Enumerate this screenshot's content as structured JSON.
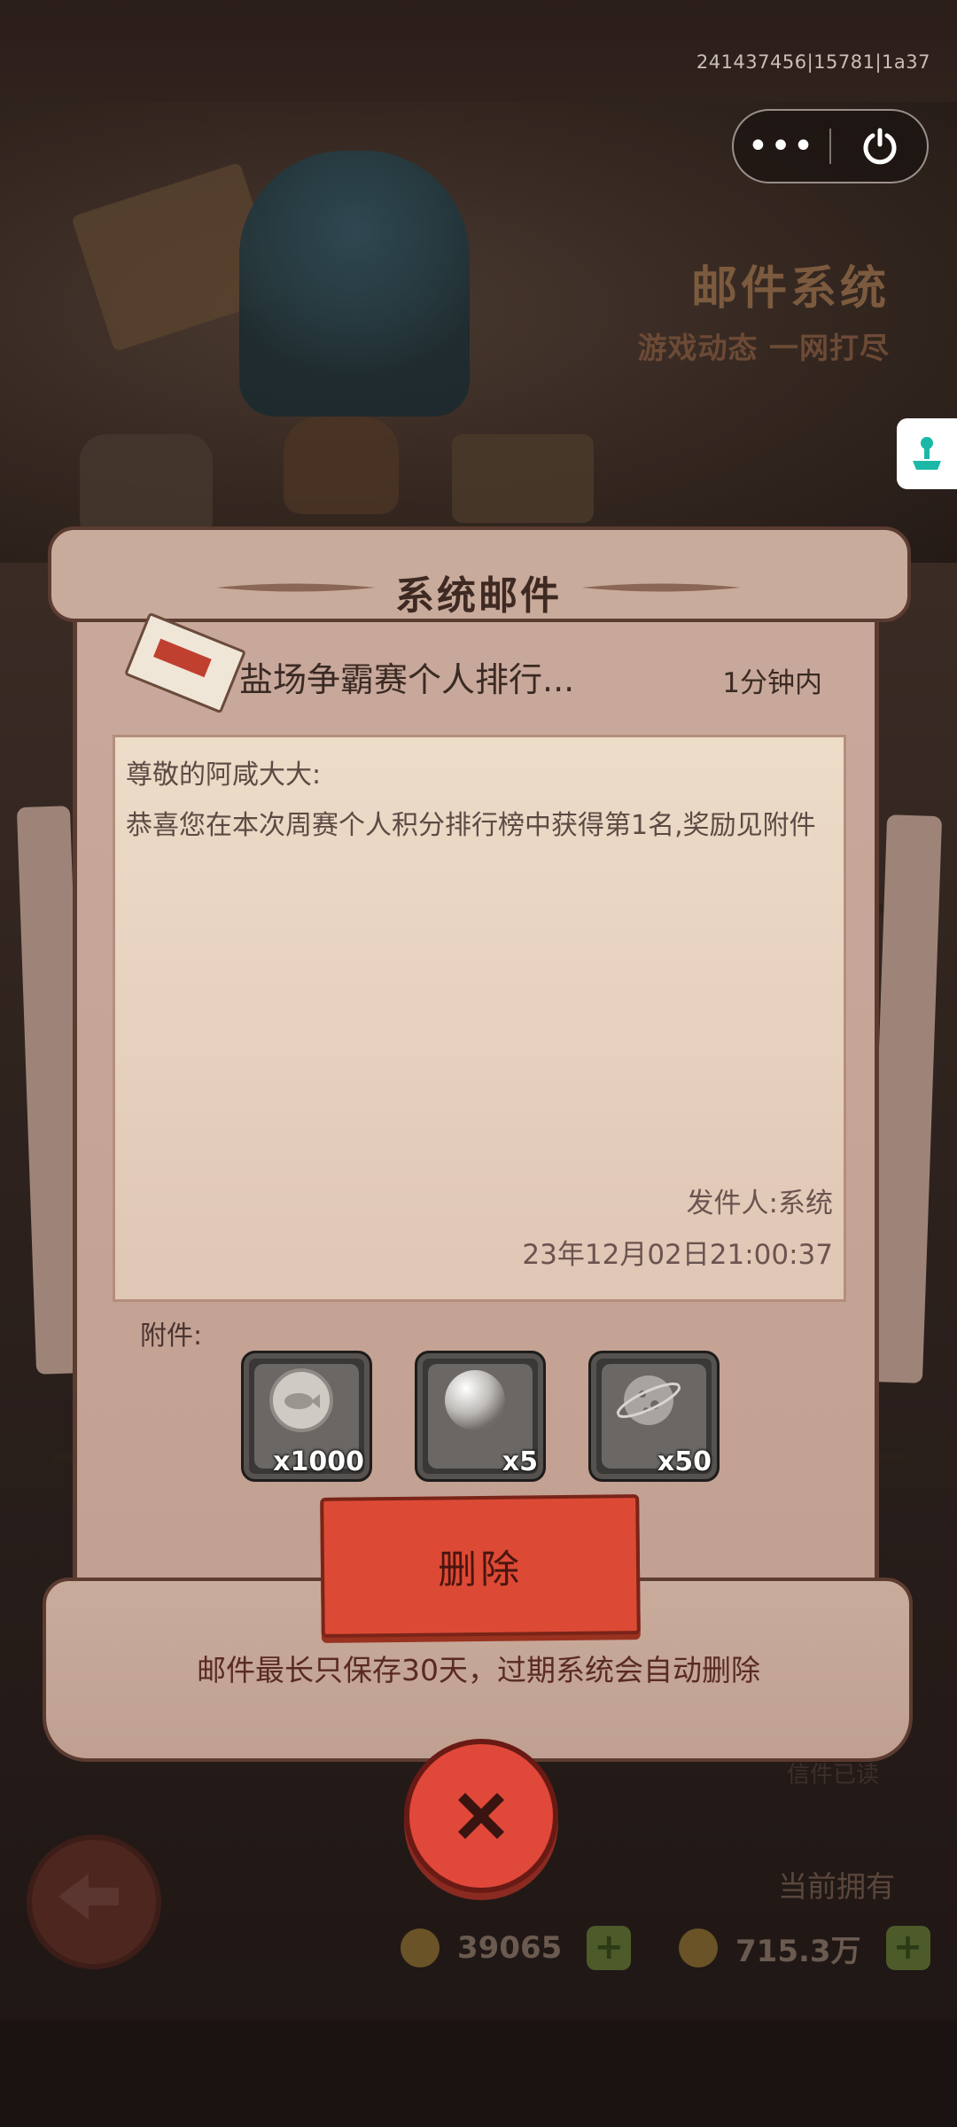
{
  "system": {
    "id_text": "241437456|15781|1a37"
  },
  "capsule": {
    "more_glyph": "•••"
  },
  "header": {
    "title": "邮件系统",
    "subtitle": "游戏动态 一网打尽"
  },
  "dialog": {
    "title": "系统邮件",
    "subject": "盐场争霸赛个人排行...",
    "time": "1分钟内",
    "greeting": "尊敬的阿咸大大:",
    "body": "恭喜您在本次周赛个人积分排行榜中获得第1名,奖励见附件",
    "sender": "发件人:系统",
    "date": "23年12月02日21:00:37",
    "attachments_label": "附件:",
    "attachments": [
      {
        "icon": "fish-coin-icon",
        "count": "x1000"
      },
      {
        "icon": "pearl-icon",
        "count": "x5"
      },
      {
        "icon": "planet-icon",
        "count": "x50"
      }
    ],
    "delete_label": "删除",
    "footer_note": "邮件最长只保存30天，过期系统会自动删除"
  },
  "background": {
    "read_label": "信件已读",
    "current_label": "当前拥有",
    "resources": [
      {
        "icon": "bone-icon",
        "value": "39065"
      },
      {
        "icon": "coin-icon",
        "value": "715.3万"
      }
    ]
  },
  "colors": {
    "dialog_paper": "#c8a99b",
    "delete_button": "#dc4a35",
    "close_button": "#e0483a",
    "text_dark": "#3e2a22"
  }
}
